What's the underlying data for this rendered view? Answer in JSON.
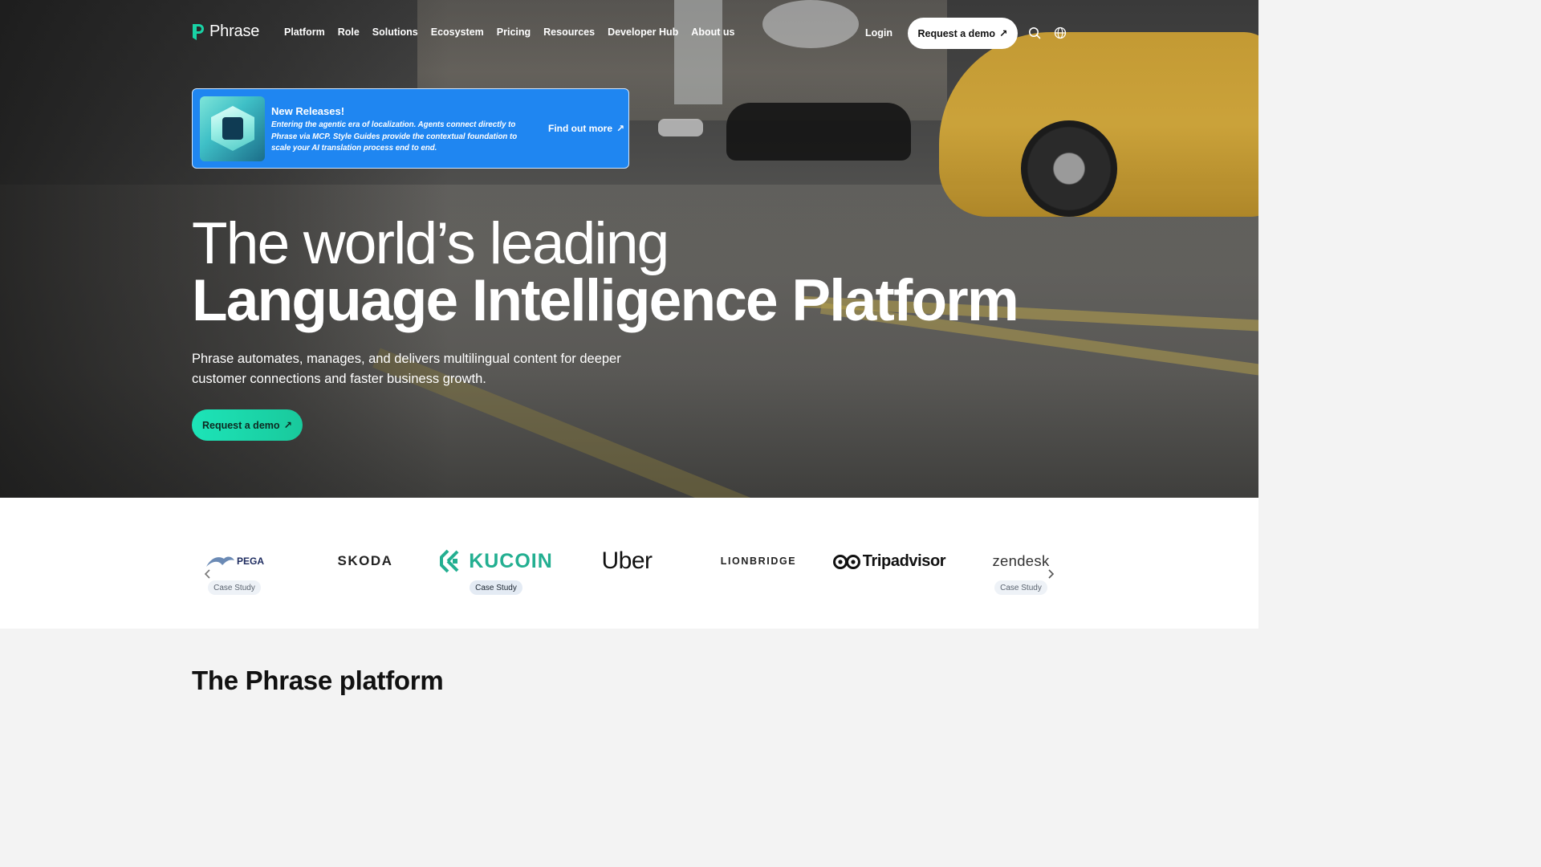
{
  "nav": {
    "logo_text": "Phrase",
    "menu": [
      "Platform",
      "Role",
      "Solutions",
      "Ecosystem",
      "Pricing",
      "Resources",
      "Developer Hub",
      "About us"
    ],
    "login_label": "Login",
    "demo_label": "Request a demo",
    "arrow_glyph": "↗"
  },
  "banner": {
    "title": "New Releases!",
    "body": "Entering the agentic era of localization. Agents connect directly to Phrase via MCP. Style Guides provide the contextual foundation to scale your AI translation process end to end.",
    "cta": "Find out more",
    "bg_color": "#1f86f1"
  },
  "hero": {
    "headline_light": "The world’s leading",
    "headline_bold": "Language Intelligence Platform",
    "subtext": "Phrase automates, manages, and delivers multilingual content for deeper customer connections and faster business growth.",
    "cta": "Request a demo",
    "cta_color": "#1de4b8"
  },
  "clients": {
    "items": [
      {
        "name": "PEGA",
        "tag": "Case Study"
      },
      {
        "name": "SKODA",
        "tag": ""
      },
      {
        "name": "KUCOIN",
        "tag": "Case Study"
      },
      {
        "name": "Uber",
        "tag": ""
      },
      {
        "name": "LIONBRIDGE",
        "tag": ""
      },
      {
        "name": "Tripadvisor",
        "tag": ""
      },
      {
        "name": "zendesk",
        "tag": "Case Study"
      }
    ],
    "kucoin_color": "#23af91"
  },
  "section": {
    "title": "The Phrase platform"
  }
}
